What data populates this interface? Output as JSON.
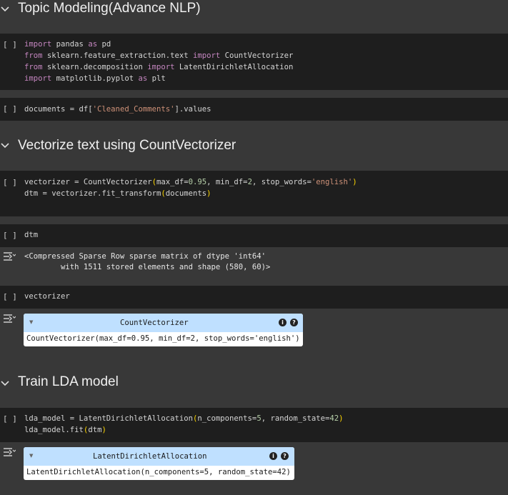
{
  "headings": {
    "topic_modeling": "Topic Modeling(Advance NLP)",
    "vectorize": "Vectorize text using CountVectorizer",
    "train_lda": "Train LDA model"
  },
  "run_button_label": "[ ]",
  "cells": {
    "imports": {
      "l1_import": "import",
      "l1_rest": " pandas ",
      "l1_as": "as",
      "l1_end": " pd",
      "l2_from": "from",
      "l2_mid": " sklearn.feature_extraction.text ",
      "l2_import": "import",
      "l2_end": " CountVectorizer",
      "l3_from": "from",
      "l3_mid": " sklearn.decomposition ",
      "l3_import": "import",
      "l3_end": " LatentDirichletAllocation",
      "l4_import": "import",
      "l4_rest": " matplotlib.pyplot ",
      "l4_as": "as",
      "l4_end": " plt"
    },
    "documents": {
      "a": "documents = df[",
      "str": "'Cleaned_Comments'",
      "b": "].values"
    },
    "vectorizer_def": {
      "l1_a": "vectorizer = CountVectorizer",
      "l1_p1": "(",
      "l1_b": "max_df=",
      "l1_n1": "0.95",
      "l1_c": ", min_df=",
      "l1_n2": "2",
      "l1_d": ", stop_words=",
      "l1_s": "'english'",
      "l1_p2": ")",
      "l2_a": "dtm = vectorizer.fit_transform",
      "l2_p1": "(",
      "l2_b": "documents",
      "l2_p2": ")"
    },
    "dtm": {
      "code": "dtm"
    },
    "dtm_output": {
      "line1": "<Compressed Sparse Row sparse matrix of dtype 'int64'",
      "line2": "        with 1511 stored elements and shape (580, 60)>"
    },
    "vectorizer_show": {
      "code": "vectorizer"
    },
    "vectorizer_output": {
      "name": "CountVectorizer",
      "repr": "CountVectorizer(max_df=0.95, min_df=2, stop_words='english')",
      "info": "i",
      "help": "?"
    },
    "lda": {
      "l1_a": "lda_model = LatentDirichletAllocation",
      "l1_p1": "(",
      "l1_b": "n_components=",
      "l1_n1": "5",
      "l1_c": ", random_state=",
      "l1_n2": "42",
      "l1_p2": ")",
      "l2_a": "lda_model.fit",
      "l2_p1": "(",
      "l2_b": "dtm",
      "l2_p2": ")"
    },
    "lda_output": {
      "name": "LatentDirichletAllocation",
      "repr": "LatentDirichletAllocation(n_components=5, random_state=42)",
      "info": "i",
      "help": "?"
    }
  }
}
